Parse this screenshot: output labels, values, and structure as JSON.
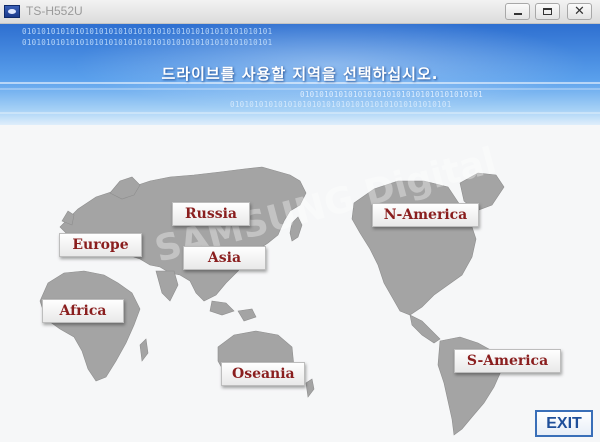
{
  "window": {
    "title": "TS-H552U",
    "controls": {
      "minimize": "—",
      "maximize": "□",
      "close": "✕"
    }
  },
  "banner": {
    "heading": "드라이브를 사용할 지역을 선택하십시오.",
    "binary_line_1": "0101010101010101010101010101010101010101010101010101",
    "binary_line_2": "0101010101010101010101010101010101010101010101010101",
    "binary_line_3": "01010101010101010101010101010101010101",
    "binary_line_4": "0101010101010101010101010101010101010101010101"
  },
  "map": {
    "watermark": "SAMSUNG Digital",
    "regions": [
      {
        "id": "russia",
        "label": "Russia"
      },
      {
        "id": "europe",
        "label": "Europe"
      },
      {
        "id": "asia",
        "label": "Asia"
      },
      {
        "id": "africa",
        "label": "Africa"
      },
      {
        "id": "oseania",
        "label": "Oseania"
      },
      {
        "id": "n-america",
        "label": "N-America"
      },
      {
        "id": "s-america",
        "label": "S-America"
      }
    ]
  },
  "footer": {
    "exit_label": "EXIT"
  },
  "colors": {
    "banner_top": "#2e6fd0",
    "banner_bottom": "#dfeefb",
    "land": "#a4a4a4",
    "region_text": "#8a1e1e",
    "exit_border": "#3a6fb8"
  }
}
